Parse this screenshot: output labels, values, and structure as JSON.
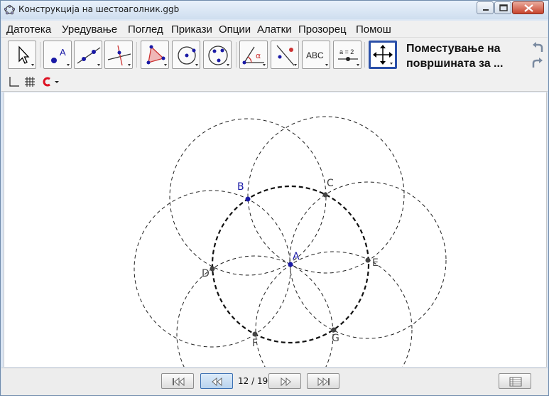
{
  "window": {
    "title": "Конструкција на шестоаголник.ggb",
    "controls": [
      "minimize-icon",
      "maximize-icon",
      "close-icon"
    ]
  },
  "menu": {
    "items": [
      "Датотека",
      "Уредување",
      "Поглед",
      "Прикази",
      "Опции",
      "Алатки",
      "Прозорец",
      "Помош"
    ]
  },
  "toolbar": {
    "tools": [
      {
        "name": "move-tool-icon"
      },
      {
        "name": "new-point-tool-icon",
        "glyph": "A"
      },
      {
        "name": "line-tool-icon"
      },
      {
        "name": "perpendicular-line-tool-icon"
      },
      {
        "name": "polygon-tool-icon"
      },
      {
        "name": "circle-center-point-tool-icon"
      },
      {
        "name": "circle-three-points-tool-icon"
      },
      {
        "name": "angle-tool-icon",
        "glyph": "α"
      },
      {
        "name": "reflect-tool-icon"
      },
      {
        "name": "text-tool-icon",
        "glyph": "ABC"
      },
      {
        "name": "slider-tool-icon",
        "glyph": "a = 2"
      },
      {
        "name": "move-graphics-view-tool-icon"
      }
    ],
    "active_tool_help_line1": "Поместување на",
    "active_tool_help_line2": "површината за ..."
  },
  "points": [
    {
      "label": "A",
      "color": "#1a1aa6"
    },
    {
      "label": "B",
      "color": "#1a1aa6"
    },
    {
      "label": "C",
      "color": "#444444"
    },
    {
      "label": "D",
      "color": "#444444"
    },
    {
      "label": "E",
      "color": "#444444"
    },
    {
      "label": "F",
      "color": "#444444"
    },
    {
      "label": "G",
      "color": "#444444"
    }
  ],
  "navigation": {
    "step_text": "12 / 19",
    "buttons": [
      "first-step-icon",
      "previous-step-icon",
      "next-step-icon",
      "last-step-icon"
    ],
    "protocol_button": "construction-protocol-icon"
  },
  "colors": {
    "accent": "#2a4fa8",
    "point_free": "#1a1aa6",
    "point_dependent": "#444444"
  }
}
